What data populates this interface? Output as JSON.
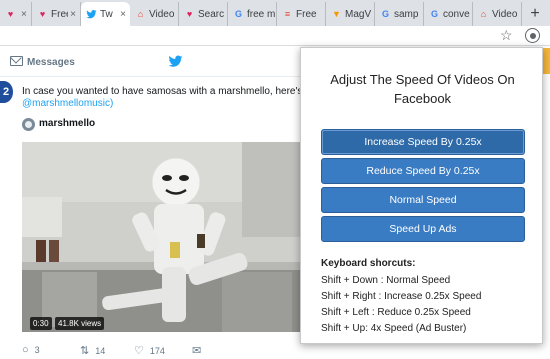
{
  "browser": {
    "tabs": [
      {
        "title": "",
        "icon": "heart-icon"
      },
      {
        "title": "Free V",
        "icon": "heart-icon"
      },
      {
        "title": "Tw",
        "icon": "twitter-icon",
        "active": true
      },
      {
        "title": "Video",
        "icon": "book-icon"
      },
      {
        "title": "Searc",
        "icon": "heart-icon"
      },
      {
        "title": "free m",
        "icon": "google-icon"
      },
      {
        "title": "Free",
        "icon": "stack-icon"
      },
      {
        "title": "MagV",
        "icon": "mag-icon"
      },
      {
        "title": "samp",
        "icon": "google-icon"
      },
      {
        "title": "conve",
        "icon": "google-icon"
      },
      {
        "title": "Video",
        "icon": "book-icon"
      }
    ],
    "new_tab": "+",
    "close_glyph": "×"
  },
  "twitter": {
    "header_label": "Messages",
    "tweet_text": "In case you wanted to have samosas with a marshmello, here's how",
    "tweet_link": "@marshmellomusic)",
    "avatar_badge": "2",
    "card_author": "marshmello",
    "video": {
      "duration": "0:30",
      "views": "41.8K views"
    },
    "actions": {
      "replies": "3",
      "retweets": "14",
      "likes": "174"
    }
  },
  "popup": {
    "title": "Adjust The Speed Of Videos On Facebook",
    "buttons": [
      "Increase Speed By 0.25x",
      "Reduce Speed By 0.25x",
      "Normal Speed",
      "Speed Up Ads"
    ],
    "shortcuts_heading": "Keyboard shorcuts:",
    "shortcuts": [
      "Shift + Down : Normal Speed",
      "Shift + Right : Increase 0.25x Speed",
      "Shift + Left : Reduce 0.25x Speed",
      "Shift + Up: 4x Speed (Ad Buster)"
    ]
  },
  "colors": {
    "accent": "#3a7cc4",
    "twitter_blue": "#1da1f2",
    "tab_strip": "#dee1e6"
  }
}
